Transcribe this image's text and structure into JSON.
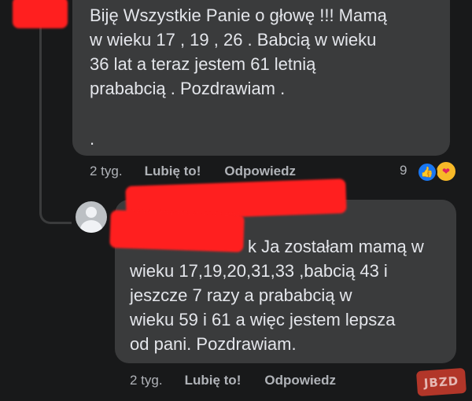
{
  "comments": [
    {
      "text_lines": [
        "Biję Wszystkie Panie o głowę !!! Mamą",
        "w wieku 17 , 19 , 26 . Babcią w wieku",
        "36 lat a teraz jestem 61 letnią",
        "prababcią . Pozdrawiam ."
      ],
      "trailing": ".",
      "time": "2 tyg.",
      "like_label": "Lubię to!",
      "reply_label": "Odpowiedz",
      "reaction_count": "9",
      "reactions": [
        "like-icon",
        "care-icon"
      ]
    },
    {
      "text_lines": [
        "k Ja zostałam mamą w",
        "wieku 17,19,20,31,33 ,babcią 43  i",
        "jeszcze 7 razy a prababcią w",
        "wieku 59 i 61 a więc jestem lepsza",
        "od pani. Pozdrawiam."
      ],
      "time": "2 tyg.",
      "like_label": "Lubię to!",
      "reply_label": "Odpowiedz"
    }
  ],
  "watermark": "JBZD",
  "colors": {
    "background": "#18191a",
    "bubble": "#3a3b3c",
    "redaction": "#ff1f1f",
    "like_blue": "#1877f2"
  }
}
